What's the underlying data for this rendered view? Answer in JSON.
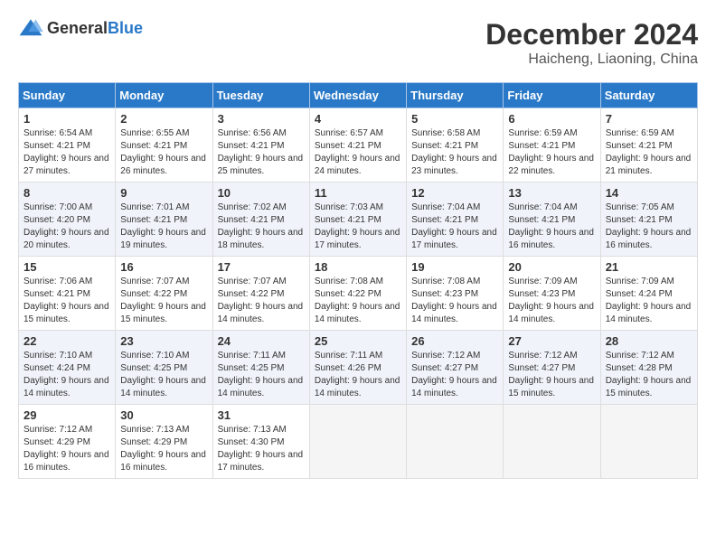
{
  "header": {
    "logo_general": "General",
    "logo_blue": "Blue",
    "month": "December 2024",
    "location": "Haicheng, Liaoning, China"
  },
  "weekdays": [
    "Sunday",
    "Monday",
    "Tuesday",
    "Wednesday",
    "Thursday",
    "Friday",
    "Saturday"
  ],
  "weeks": [
    [
      {
        "day": "1",
        "sunrise": "6:54 AM",
        "sunset": "4:21 PM",
        "daylight": "9 hours and 27 minutes."
      },
      {
        "day": "2",
        "sunrise": "6:55 AM",
        "sunset": "4:21 PM",
        "daylight": "9 hours and 26 minutes."
      },
      {
        "day": "3",
        "sunrise": "6:56 AM",
        "sunset": "4:21 PM",
        "daylight": "9 hours and 25 minutes."
      },
      {
        "day": "4",
        "sunrise": "6:57 AM",
        "sunset": "4:21 PM",
        "daylight": "9 hours and 24 minutes."
      },
      {
        "day": "5",
        "sunrise": "6:58 AM",
        "sunset": "4:21 PM",
        "daylight": "9 hours and 23 minutes."
      },
      {
        "day": "6",
        "sunrise": "6:59 AM",
        "sunset": "4:21 PM",
        "daylight": "9 hours and 22 minutes."
      },
      {
        "day": "7",
        "sunrise": "6:59 AM",
        "sunset": "4:21 PM",
        "daylight": "9 hours and 21 minutes."
      }
    ],
    [
      {
        "day": "8",
        "sunrise": "7:00 AM",
        "sunset": "4:20 PM",
        "daylight": "9 hours and 20 minutes."
      },
      {
        "day": "9",
        "sunrise": "7:01 AM",
        "sunset": "4:21 PM",
        "daylight": "9 hours and 19 minutes."
      },
      {
        "day": "10",
        "sunrise": "7:02 AM",
        "sunset": "4:21 PM",
        "daylight": "9 hours and 18 minutes."
      },
      {
        "day": "11",
        "sunrise": "7:03 AM",
        "sunset": "4:21 PM",
        "daylight": "9 hours and 17 minutes."
      },
      {
        "day": "12",
        "sunrise": "7:04 AM",
        "sunset": "4:21 PM",
        "daylight": "9 hours and 17 minutes."
      },
      {
        "day": "13",
        "sunrise": "7:04 AM",
        "sunset": "4:21 PM",
        "daylight": "9 hours and 16 minutes."
      },
      {
        "day": "14",
        "sunrise": "7:05 AM",
        "sunset": "4:21 PM",
        "daylight": "9 hours and 16 minutes."
      }
    ],
    [
      {
        "day": "15",
        "sunrise": "7:06 AM",
        "sunset": "4:21 PM",
        "daylight": "9 hours and 15 minutes."
      },
      {
        "day": "16",
        "sunrise": "7:07 AM",
        "sunset": "4:22 PM",
        "daylight": "9 hours and 15 minutes."
      },
      {
        "day": "17",
        "sunrise": "7:07 AM",
        "sunset": "4:22 PM",
        "daylight": "9 hours and 14 minutes."
      },
      {
        "day": "18",
        "sunrise": "7:08 AM",
        "sunset": "4:22 PM",
        "daylight": "9 hours and 14 minutes."
      },
      {
        "day": "19",
        "sunrise": "7:08 AM",
        "sunset": "4:23 PM",
        "daylight": "9 hours and 14 minutes."
      },
      {
        "day": "20",
        "sunrise": "7:09 AM",
        "sunset": "4:23 PM",
        "daylight": "9 hours and 14 minutes."
      },
      {
        "day": "21",
        "sunrise": "7:09 AM",
        "sunset": "4:24 PM",
        "daylight": "9 hours and 14 minutes."
      }
    ],
    [
      {
        "day": "22",
        "sunrise": "7:10 AM",
        "sunset": "4:24 PM",
        "daylight": "9 hours and 14 minutes."
      },
      {
        "day": "23",
        "sunrise": "7:10 AM",
        "sunset": "4:25 PM",
        "daylight": "9 hours and 14 minutes."
      },
      {
        "day": "24",
        "sunrise": "7:11 AM",
        "sunset": "4:25 PM",
        "daylight": "9 hours and 14 minutes."
      },
      {
        "day": "25",
        "sunrise": "7:11 AM",
        "sunset": "4:26 PM",
        "daylight": "9 hours and 14 minutes."
      },
      {
        "day": "26",
        "sunrise": "7:12 AM",
        "sunset": "4:27 PM",
        "daylight": "9 hours and 14 minutes."
      },
      {
        "day": "27",
        "sunrise": "7:12 AM",
        "sunset": "4:27 PM",
        "daylight": "9 hours and 15 minutes."
      },
      {
        "day": "28",
        "sunrise": "7:12 AM",
        "sunset": "4:28 PM",
        "daylight": "9 hours and 15 minutes."
      }
    ],
    [
      {
        "day": "29",
        "sunrise": "7:12 AM",
        "sunset": "4:29 PM",
        "daylight": "9 hours and 16 minutes."
      },
      {
        "day": "30",
        "sunrise": "7:13 AM",
        "sunset": "4:29 PM",
        "daylight": "9 hours and 16 minutes."
      },
      {
        "day": "31",
        "sunrise": "7:13 AM",
        "sunset": "4:30 PM",
        "daylight": "9 hours and 17 minutes."
      },
      null,
      null,
      null,
      null
    ]
  ]
}
